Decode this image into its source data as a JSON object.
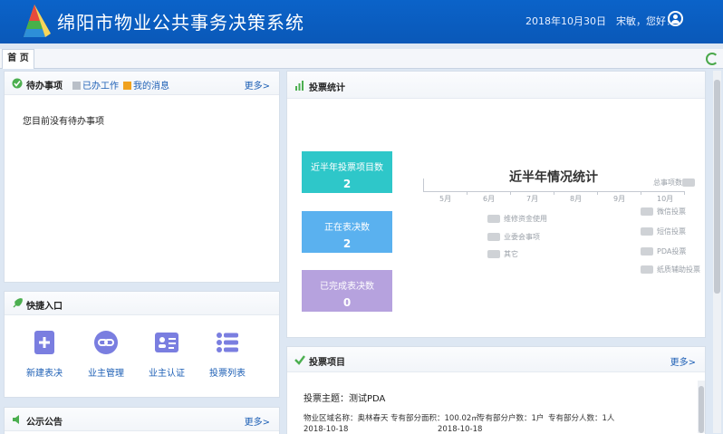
{
  "header": {
    "app_title": "绵阳市物业公共事务决策系统",
    "date": "2018年10月30日",
    "greeting": "宋敏，您好！"
  },
  "tabs": {
    "home": "首 页"
  },
  "todo": {
    "title": "待办事项",
    "done_tab": "已办工作",
    "messages_tab": "我的消息",
    "more": "更多>",
    "empty_text": "您目前没有待办事项"
  },
  "quick": {
    "title": "快捷入口",
    "items": [
      {
        "label": "新建表决",
        "icon": "add-document-icon"
      },
      {
        "label": "业主管理",
        "icon": "link-icon"
      },
      {
        "label": "业主认证",
        "icon": "id-card-icon"
      },
      {
        "label": "投票列表",
        "icon": "list-icon"
      }
    ]
  },
  "notice": {
    "title": "公示公告",
    "more": "更多>"
  },
  "vote_stats": {
    "title": "投票统计",
    "stats": [
      {
        "label": "近半年投票项目数",
        "value": "2",
        "color": "#2ec7c9"
      },
      {
        "label": "正在表决数",
        "value": "2",
        "color": "#5ab1ef"
      },
      {
        "label": "已完成表决数",
        "value": "0",
        "color": "#b6a2de"
      }
    ]
  },
  "chart_data": {
    "type": "bar",
    "title": "近半年情况统计",
    "categories": [
      "5月",
      "6月",
      "7月",
      "8月",
      "9月",
      "10月"
    ],
    "legend": [
      "总事项数",
      "微信投票",
      "短信投票",
      "PDA投票",
      "纸质辅助投票",
      "维修资金使用",
      "业委会事项",
      "其它"
    ]
  },
  "projects": {
    "title": "投票项目",
    "more": "更多>",
    "item": {
      "subject_label": "投票主题：",
      "subject": "测试PDA",
      "area_label": "物业区域名称：",
      "area": "奥林春天",
      "own_area_label": "专有部分面积：",
      "own_area": "100.02㎡",
      "households_label": "专有部分户数：",
      "households": "1户",
      "persons_label": "专有部分人数：",
      "persons": "1人",
      "date1": "2018-10-18",
      "date2": "2018-10-18"
    }
  }
}
